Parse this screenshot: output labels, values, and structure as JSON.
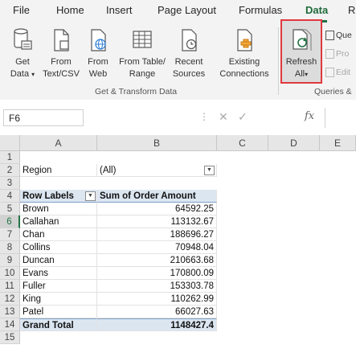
{
  "menu": {
    "tabs": [
      "File",
      "Home",
      "Insert",
      "Page Layout",
      "Formulas",
      "Data",
      "R"
    ]
  },
  "ribbon": {
    "get_data": {
      "line1": "Get",
      "line2": "Data"
    },
    "from_text": {
      "line1": "From",
      "line2": "Text/CSV"
    },
    "from_web": {
      "line1": "From",
      "line2": "Web"
    },
    "from_table": {
      "line1": "From Table/",
      "line2": "Range"
    },
    "recent_sources": {
      "line1": "Recent",
      "line2": "Sources"
    },
    "existing_connections": {
      "line1": "Existing",
      "line2": "Connections"
    },
    "refresh_all": {
      "line1": "Refresh",
      "line2": "All"
    },
    "group_get_transform": "Get & Transform Data",
    "group_queries": "Queries &",
    "side_queries": "Que",
    "side_properties": "Pro",
    "side_edit": "Edit"
  },
  "formula_bar": {
    "name_box": "F6",
    "fx": "fx"
  },
  "columns": [
    "A",
    "B",
    "C",
    "D",
    "E"
  ],
  "rows": [
    "1",
    "2",
    "3",
    "4",
    "5",
    "6",
    "7",
    "8",
    "9",
    "10",
    "11",
    "12",
    "13",
    "14",
    "15"
  ],
  "pivot": {
    "filter_label": "Region",
    "filter_value": "(All)",
    "row_labels_header": "Row Labels",
    "sum_header": "Sum of Order Amount",
    "items": [
      {
        "name": "Brown",
        "value": "64592.25"
      },
      {
        "name": "Callahan",
        "value": "113132.67"
      },
      {
        "name": "Chan",
        "value": "188696.27"
      },
      {
        "name": "Collins",
        "value": "70948.04"
      },
      {
        "name": "Duncan",
        "value": "210663.68"
      },
      {
        "name": "Evans",
        "value": "170800.09"
      },
      {
        "name": "Fuller",
        "value": "153303.78"
      },
      {
        "name": "King",
        "value": "110262.99"
      },
      {
        "name": "Patel",
        "value": "66027.63"
      }
    ],
    "grand_total_label": "Grand Total",
    "grand_total_value": "1148427.4"
  },
  "colors": {
    "accent": "#217346",
    "highlight_border": "#e0393e"
  }
}
